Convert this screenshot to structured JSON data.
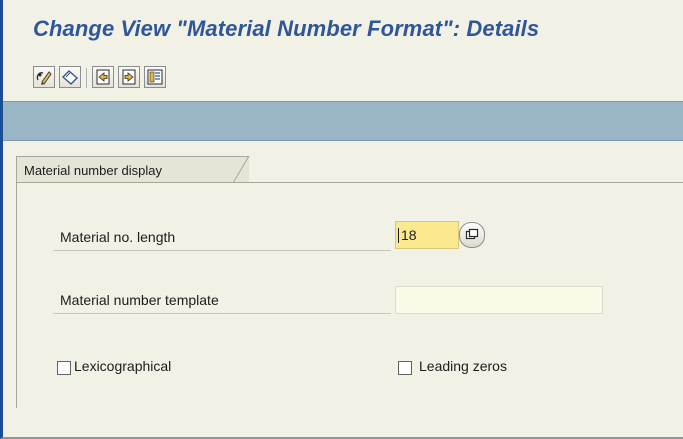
{
  "window": {
    "title": "Change View \"Material Number Format\": Details"
  },
  "toolbar": {
    "buttons": [
      {
        "name": "display-change-icon"
      },
      {
        "name": "undo-change-icon"
      },
      {
        "name": "previous-entry-icon"
      },
      {
        "name": "next-entry-icon"
      },
      {
        "name": "variable-list-icon"
      }
    ]
  },
  "group": {
    "title": "Material number display"
  },
  "fields": {
    "length_label": "Material no. length",
    "length_value": "18",
    "template_label": "Material number template",
    "template_value": ""
  },
  "checkboxes": {
    "lexicographical_label": "Lexicographical",
    "lexicographical_checked": false,
    "leading_zeros_label": "Leading zeros",
    "leading_zeros_checked": false
  },
  "colors": {
    "title": "#2f5699",
    "band": "#9ab5c6",
    "active_field": "#fbe990",
    "background": "#f2f1e6"
  }
}
